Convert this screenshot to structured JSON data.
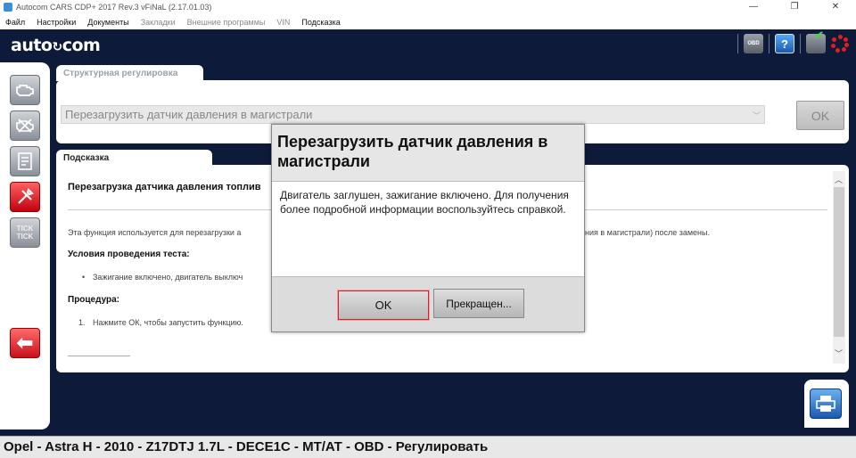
{
  "window": {
    "title": "Autocom CARS CDP+ 2017 Rev.3 vFiNaL (2.17.01.03)",
    "minimize": "—",
    "restore": "❐",
    "close": "✕"
  },
  "menu": {
    "items": [
      {
        "label": "Файл",
        "enabled": true
      },
      {
        "label": "Настройки",
        "enabled": true
      },
      {
        "label": "Документы",
        "enabled": true
      },
      {
        "label": "Закладки",
        "enabled": false
      },
      {
        "label": "Внешние программы",
        "enabled": false
      },
      {
        "label": "VIN",
        "enabled": false
      },
      {
        "label": "Подсказка",
        "enabled": true
      }
    ]
  },
  "header": {
    "logo_left": "auto",
    "logo_right": "com",
    "obd_label": "OBD",
    "help_label": "?"
  },
  "structure": {
    "tab_label": "Структурная регулировка",
    "selected_function": "Перезагрузить датчик давления в магистрали",
    "ok_label": "OK"
  },
  "hint": {
    "tab_label": "Подсказка",
    "title": "Перезагрузка датчика давления топлив",
    "intro_left": "Эта функция используется для перезагрузки а",
    "intro_right": "ния в магистрали) после замены.",
    "conditions_heading": "Условия проведения теста:",
    "condition_1": "Зажигание включено, двигатель выключ",
    "procedure_heading": "Процедура:",
    "step_1_num": "1.",
    "step_1": "Нажмите ОК, чтобы запустить функцию."
  },
  "sidebar": {
    "tick_label": "TICK\nTICK"
  },
  "modal": {
    "title": "Перезагрузить датчик давления в магистрали",
    "message": "Двигатель заглушен, зажигание включено. Для получения более подробной информации воспользуйтесь справкой.",
    "ok_label": "OK",
    "cancel_label": "Прекращен..."
  },
  "status": {
    "vehicle": "Opel - Astra H - 2010 - Z17DTJ 1.7L - DECE1C - MT/AT - OBD - Регулировать"
  },
  "colors": {
    "background": "#0d1a3a",
    "accent_red": "#d42030",
    "accent_blue": "#1a5ab0"
  }
}
